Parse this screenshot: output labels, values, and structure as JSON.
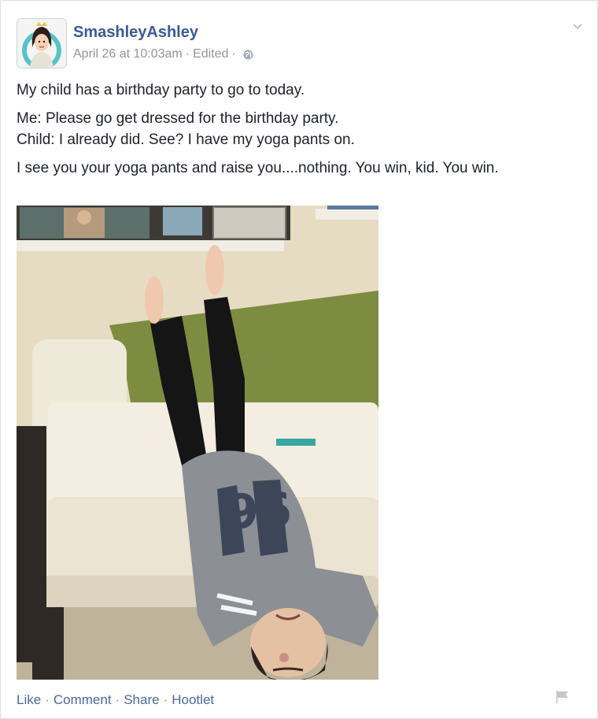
{
  "post": {
    "author": "SmashleyAshley",
    "date": "April 26 at 10:03am",
    "edited": "Edited",
    "privacy_icon": "globe-icon",
    "menu_icon": "chevron-down-icon",
    "lines": [
      "My child has a birthday party to go to today.",
      "Me: Please go get dressed for the birthday party.",
      "Child: I already did. See? I have my yoga pants on.",
      "I see you your yoga pants and raise you....nothing. You win, kid. You win."
    ],
    "photo_jersey_number": "96"
  },
  "actions": {
    "like": "Like",
    "comment": "Comment",
    "share": "Share",
    "hootlet": "Hootlet",
    "report_icon": "flag-icon"
  },
  "colors": {
    "link": "#3b5998",
    "action_link": "#4b67a1",
    "muted": "#90949c",
    "text": "#1d2129"
  }
}
